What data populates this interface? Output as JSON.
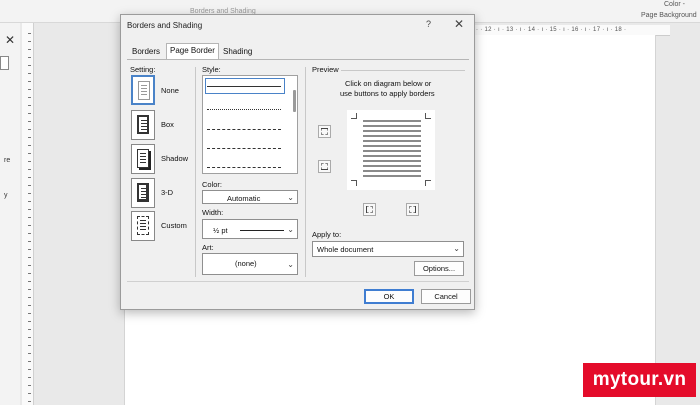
{
  "background": {
    "ribbon_text_left": "Color -",
    "ribbon_text_right": "Page Background",
    "top_partial_text": "Borders and Shading",
    "ruler_numbers": "· · 12 · ı · 13 · ı · 14 · ı · 15 · ı · 16 · ı · 17 · ı · 18 ·",
    "side_letters": [
      "re",
      "y"
    ]
  },
  "dialog": {
    "title": "Borders and Shading",
    "help_icon": "question-icon",
    "close_icon": "close-icon",
    "tabs": [
      {
        "label": "Borders",
        "active": false
      },
      {
        "label": "Page Border",
        "active": true
      },
      {
        "label": "Shading",
        "active": false
      }
    ],
    "setting": {
      "label": "Setting:",
      "options": [
        {
          "label": "None",
          "selected": true
        },
        {
          "label": "Box",
          "selected": false
        },
        {
          "label": "Shadow",
          "selected": false
        },
        {
          "label": "3-D",
          "selected": false
        },
        {
          "label": "Custom",
          "selected": false
        }
      ]
    },
    "style": {
      "label": "Style:",
      "line_types": [
        "solid",
        "dotted",
        "dashed",
        "dash-dot"
      ]
    },
    "color": {
      "label": "Color:",
      "value": "Automatic"
    },
    "width": {
      "label": "Width:",
      "value": "½ pt"
    },
    "art": {
      "label": "Art:",
      "value": "(none)"
    },
    "preview": {
      "label": "Preview",
      "instruction_line1": "Click on diagram below or",
      "instruction_line2": "use buttons to apply borders",
      "buttons": [
        "border-top-button",
        "border-bottom-button",
        "border-left-button",
        "border-right-button"
      ]
    },
    "apply_to": {
      "label": "Apply to:",
      "value": "Whole document"
    },
    "options_label": "Options...",
    "ok_label": "OK",
    "cancel_label": "Cancel"
  },
  "watermark": "mytour.vn",
  "colors": {
    "accent": "#3f7dd1",
    "logo_red": "#e40b2a"
  }
}
